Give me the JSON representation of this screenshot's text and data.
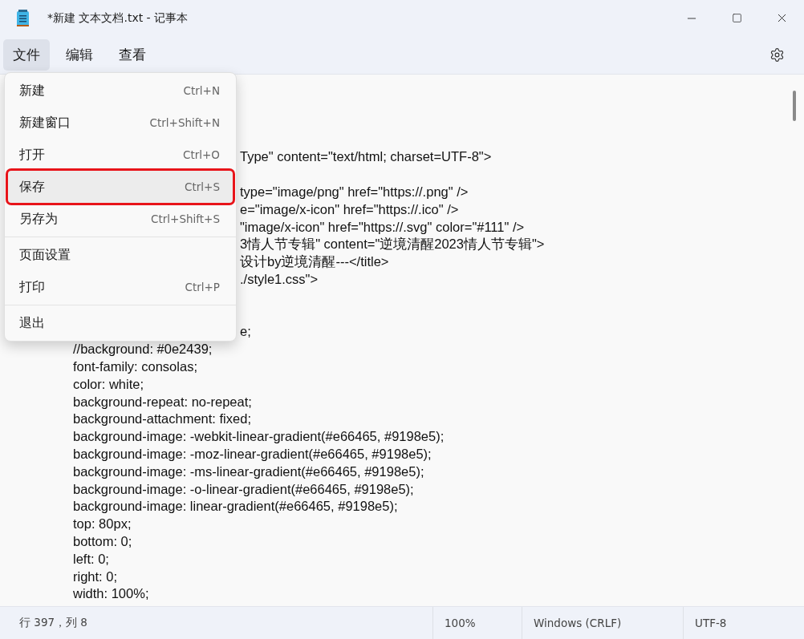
{
  "window": {
    "title": "*新建 文本文档.txt - 记事本"
  },
  "menu_bar": [
    {
      "label": "文件",
      "selected": true
    },
    {
      "label": "编辑",
      "selected": false
    },
    {
      "label": "查看",
      "selected": false
    }
  ],
  "file_menu": [
    {
      "kind": "item",
      "label": "新建",
      "shortcut": "Ctrl+N",
      "highlighted": false,
      "outlined": false
    },
    {
      "kind": "item",
      "label": "新建窗口",
      "shortcut": "Ctrl+Shift+N",
      "highlighted": false,
      "outlined": false
    },
    {
      "kind": "item",
      "label": "打开",
      "shortcut": "Ctrl+O",
      "highlighted": false,
      "outlined": false
    },
    {
      "kind": "item",
      "label": "保存",
      "shortcut": "Ctrl+S",
      "highlighted": true,
      "outlined": true
    },
    {
      "kind": "item",
      "label": "另存为",
      "shortcut": "Ctrl+Shift+S",
      "highlighted": false,
      "outlined": false
    },
    {
      "kind": "separator"
    },
    {
      "kind": "item",
      "label": "页面设置",
      "highlighted": false,
      "outlined": false
    },
    {
      "kind": "item",
      "label": "打印",
      "shortcut": "Ctrl+P",
      "highlighted": false,
      "outlined": false
    },
    {
      "kind": "separator"
    },
    {
      "kind": "item",
      "label": "退出",
      "highlighted": false,
      "outlined": false
    }
  ],
  "editor_lines": [
    {
      "kind": "hidden"
    },
    {
      "kind": "hidden"
    },
    {
      "kind": "hidden"
    },
    {
      "kind": "partial",
      "text": "Type\" content=\"text/html; charset=UTF-8\">"
    },
    {
      "kind": "hidden"
    },
    {
      "kind": "partial",
      "text": "type=\"image/png\" href=\"https://.png\" />"
    },
    {
      "kind": "partial",
      "text": "e=\"image/x-icon\" href=\"https://.ico\" />"
    },
    {
      "kind": "partial",
      "text": "\"image/x-icon\" href=\"https://.svg\" color=\"#111\" />"
    },
    {
      "kind": "partial",
      "text": "3情人节专辑\" content=\"逆境清醒2023情人节专辑\">"
    },
    {
      "kind": "partial",
      "text": "设计by逆境清醒---</title>"
    },
    {
      "kind": "partial",
      "text": "./style1.css\">"
    },
    {
      "kind": "hidden"
    },
    {
      "kind": "hidden"
    },
    {
      "kind": "partial",
      "text": "e;"
    },
    {
      "kind": "full",
      "text": "//background: #0e2439;"
    },
    {
      "kind": "full",
      "text": "font-family: consolas;"
    },
    {
      "kind": "full",
      "text": "color: white;"
    },
    {
      "kind": "full",
      "text": "background-repeat: no-repeat;"
    },
    {
      "kind": "full",
      "text": "background-attachment: fixed;"
    },
    {
      "kind": "full",
      "text": "background-image: -webkit-linear-gradient(#e66465, #9198e5);"
    },
    {
      "kind": "full",
      "text": "background-image: -moz-linear-gradient(#e66465, #9198e5);"
    },
    {
      "kind": "full",
      "text": "background-image: -ms-linear-gradient(#e66465, #9198e5);"
    },
    {
      "kind": "full",
      "text": "background-image: -o-linear-gradient(#e66465, #9198e5);"
    },
    {
      "kind": "full",
      "text": "background-image: linear-gradient(#e66465, #9198e5);"
    },
    {
      "kind": "full",
      "text": "top: 80px;"
    },
    {
      "kind": "full",
      "text": "bottom: 0;"
    },
    {
      "kind": "full",
      "text": "left: 0;"
    },
    {
      "kind": "full",
      "text": "right: 0;"
    },
    {
      "kind": "full",
      "text": "width: 100%;"
    }
  ],
  "status_bar": {
    "position": "行 397，列 8",
    "zoom": "100%",
    "line_ending": "Windows (CRLF)",
    "encoding": "UTF-8"
  }
}
